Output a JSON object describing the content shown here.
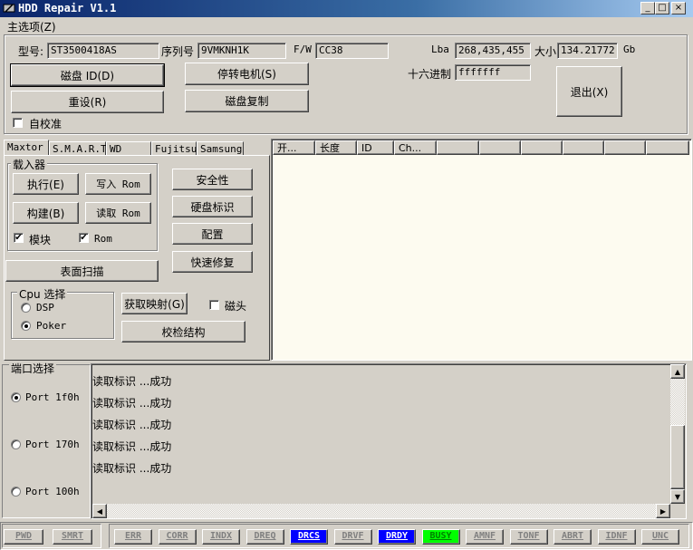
{
  "title": "HDD Repair V1.1",
  "menu": {
    "main": "主选项(Z)"
  },
  "info": {
    "model_label": "型号:",
    "model_value": "ST3500418AS",
    "serial_label": "序列号",
    "serial_value": "9VMKNH1K",
    "fw_label": "F/W",
    "fw_value": "CC38",
    "lba_label": "Lba",
    "lba_value": "268,435,455",
    "size_label": "大小",
    "size_value": "134.21772",
    "size_unit": "Gb",
    "hex_label": "十六进制",
    "hex_value": "fffffff"
  },
  "top_buttons": {
    "disk_id": "磁盘 ID(D)",
    "spindown": "停转电机(S)",
    "reset": "重设(R)",
    "copy": "磁盘复制",
    "exit": "退出(X)"
  },
  "self_check": {
    "label": "自校准",
    "checked": false
  },
  "tabs": [
    "Maxtor",
    "S.M.A.R.T",
    "WD",
    "Fujitsu",
    "Samsung"
  ],
  "loader": {
    "title": "载入器",
    "execute": "执行(E)",
    "write_rom": "写入 Rom",
    "build": "构建(B)",
    "read_rom": "读取 Rom",
    "module_label": "模块",
    "module_checked": true,
    "rom_label": "Rom",
    "rom_checked": true
  },
  "side_buttons": {
    "security": "安全性",
    "disk_id": "硬盘标识",
    "config": "配置",
    "quick_fix": "快速修复"
  },
  "surface_scan": "表面扫描",
  "cpu": {
    "title": "Cpu 选择",
    "options": [
      "DSP",
      "Poker"
    ],
    "selected": "Poker"
  },
  "get_map": "获取映射(G)",
  "head_label": "磁头",
  "verify_struct": "校检结构",
  "grid_headers": [
    "开...",
    "长度",
    "ID",
    "Ch...",
    "",
    "",
    "",
    "",
    "",
    ""
  ],
  "port": {
    "title": "端口选择",
    "options": [
      "Port 1f0h",
      "Port 170h",
      "Port 100h"
    ],
    "selected": "Port 1f0h"
  },
  "log": [
    "读取标识 ...成功",
    "读取标识 ...成功",
    "读取标识 ...成功",
    "读取标识 ...成功",
    "读取标识 ...成功"
  ],
  "status_left": [
    "PWD",
    "SMRT"
  ],
  "status_indicators": [
    {
      "label": "ERR",
      "color": "#d4d0c8"
    },
    {
      "label": "CORR",
      "color": "#d4d0c8"
    },
    {
      "label": "INDX",
      "color": "#d4d0c8"
    },
    {
      "label": "DREQ",
      "color": "#d4d0c8"
    },
    {
      "label": "DRCS",
      "color": "#0000ff"
    },
    {
      "label": "DRVF",
      "color": "#d4d0c8"
    },
    {
      "label": "DRDY",
      "color": "#0000ff"
    },
    {
      "label": "BUSY",
      "color": "#00ff00"
    },
    {
      "label": "AMNF",
      "color": "#d4d0c8"
    },
    {
      "label": "TONF",
      "color": "#d4d0c8"
    },
    {
      "label": "ABRT",
      "color": "#d4d0c8"
    },
    {
      "label": "IDNF",
      "color": "#d4d0c8"
    },
    {
      "label": "UNC",
      "color": "#d4d0c8"
    }
  ],
  "colors": {
    "titlebar": "#0a246a",
    "face": "#d4d0c8",
    "grid_bg": "#fdfbf0"
  }
}
